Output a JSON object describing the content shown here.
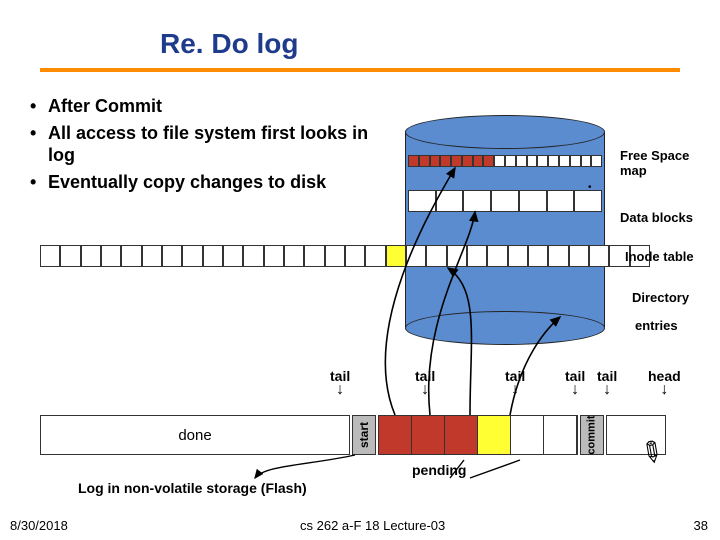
{
  "title": "Re. Do log",
  "bullets": [
    "After Commit",
    "All access to file system first looks in log",
    "Eventually copy changes to disk"
  ],
  "labels": {
    "free_space_map": "Free Space map",
    "data_blocks": "Data blocks",
    "inode_table": "Inode table",
    "directory": "Directory",
    "entries": "entries"
  },
  "pointers": {
    "tail1": "tail",
    "tail2": "tail",
    "tail3": "tail",
    "tail4": "tail",
    "tail5": "tail",
    "head": "head"
  },
  "track": {
    "done": "done",
    "start": "start",
    "commit": "commit",
    "pending": "pending"
  },
  "nonvol_label": "Log in non-volatile storage (Flash)",
  "footer": {
    "date": "8/30/2018",
    "course": "cs 262 a-F 18 Lecture-03",
    "page": "38"
  }
}
